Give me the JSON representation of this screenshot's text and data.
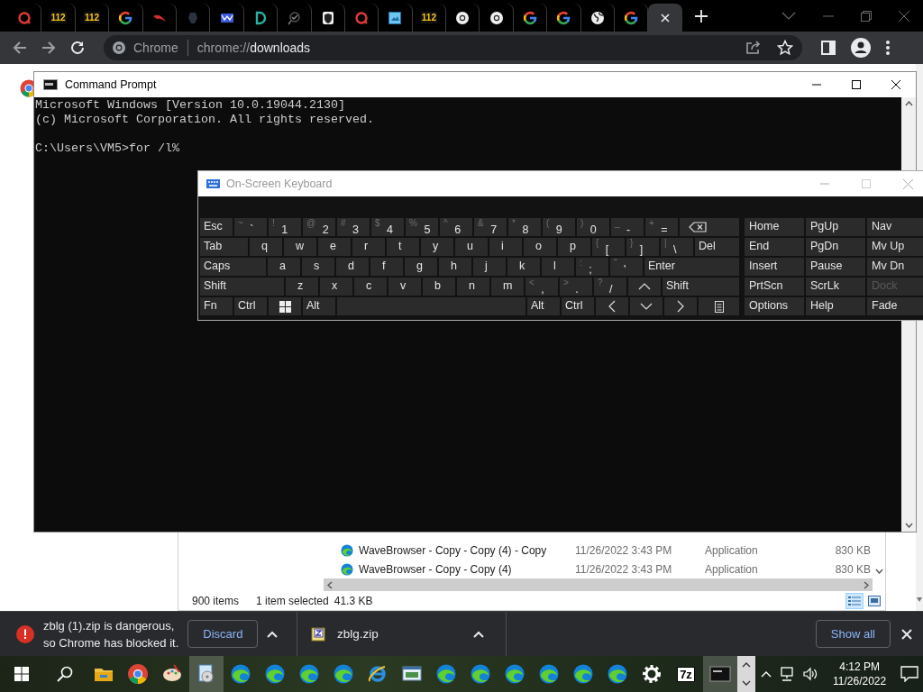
{
  "browser": {
    "tabs": [
      {
        "kind": "ring",
        "selected": false
      },
      {
        "kind": "badge",
        "badge": "112",
        "selected": false
      },
      {
        "kind": "badge",
        "badge": "112",
        "selected": false
      },
      {
        "kind": "google",
        "selected": false
      },
      {
        "kind": "swoosh",
        "selected": false
      },
      {
        "kind": "blot",
        "selected": false
      },
      {
        "kind": "mail",
        "selected": false
      },
      {
        "kind": "arc",
        "selected": false
      },
      {
        "kind": "check",
        "selected": false
      },
      {
        "kind": "shield",
        "selected": false
      },
      {
        "kind": "ring",
        "selected": false
      },
      {
        "kind": "image",
        "selected": false
      },
      {
        "kind": "badge",
        "badge": "112",
        "selected": false
      },
      {
        "kind": "round",
        "selected": false
      },
      {
        "kind": "round",
        "selected": false
      },
      {
        "kind": "google",
        "selected": false
      },
      {
        "kind": "google",
        "selected": false
      },
      {
        "kind": "globe",
        "selected": false
      },
      {
        "kind": "google",
        "selected": false
      },
      {
        "kind": "blank",
        "selected": true
      }
    ],
    "omnibox": {
      "chip": "Chrome",
      "url": "chrome://**downloads**"
    }
  },
  "cmd": {
    "title": "Command Prompt",
    "output": [
      "Microsoft Windows [Version 10.0.19044.2130]",
      "(c) Microsoft Corporation. All rights reserved."
    ],
    "prompt": "C:\\Users\\VM5>for /l%"
  },
  "osk": {
    "title": "On-Screen Keyboard",
    "rows": [
      [
        {
          "kind": "key",
          "label": "Esc"
        },
        {
          "kind": "char",
          "shift": "~",
          "main": "`"
        },
        {
          "kind": "char",
          "shift": "!",
          "main": "1"
        },
        {
          "kind": "char",
          "shift": "@",
          "main": "2"
        },
        {
          "kind": "char",
          "shift": "#",
          "main": "3"
        },
        {
          "kind": "char",
          "shift": "$",
          "main": "4"
        },
        {
          "kind": "char",
          "shift": "%",
          "main": "5"
        },
        {
          "kind": "char",
          "shift": "^",
          "main": "6"
        },
        {
          "kind": "char",
          "shift": "&",
          "main": "7"
        },
        {
          "kind": "char",
          "shift": "*",
          "main": "8"
        },
        {
          "kind": "char",
          "shift": "(",
          "main": "9"
        },
        {
          "kind": "char",
          "shift": ")",
          "main": "0"
        },
        {
          "kind": "char",
          "shift": "_",
          "main": "-"
        },
        {
          "kind": "char",
          "shift": "+",
          "main": "="
        },
        {
          "kind": "backspace"
        }
      ],
      [
        {
          "kind": "key",
          "label": "Tab"
        },
        {
          "kind": "key",
          "label": "q"
        },
        {
          "kind": "key",
          "label": "w"
        },
        {
          "kind": "key",
          "label": "e"
        },
        {
          "kind": "key",
          "label": "r"
        },
        {
          "kind": "key",
          "label": "t"
        },
        {
          "kind": "key",
          "label": "y"
        },
        {
          "kind": "key",
          "label": "u"
        },
        {
          "kind": "key",
          "label": "i"
        },
        {
          "kind": "key",
          "label": "o"
        },
        {
          "kind": "key",
          "label": "p"
        },
        {
          "kind": "char",
          "shift": "{",
          "main": "["
        },
        {
          "kind": "char",
          "shift": "}",
          "main": "]"
        },
        {
          "kind": "char",
          "shift": "|",
          "main": "\\"
        },
        {
          "kind": "key",
          "label": "Del"
        }
      ],
      [
        {
          "kind": "key",
          "label": "Caps"
        },
        {
          "kind": "key",
          "label": "a"
        },
        {
          "kind": "key",
          "label": "s"
        },
        {
          "kind": "key",
          "label": "d"
        },
        {
          "kind": "key",
          "label": "f"
        },
        {
          "kind": "key",
          "label": "g"
        },
        {
          "kind": "key",
          "label": "h"
        },
        {
          "kind": "key",
          "label": "j"
        },
        {
          "kind": "key",
          "label": "k"
        },
        {
          "kind": "key",
          "label": "l"
        },
        {
          "kind": "char",
          "shift": ":",
          "main": ";"
        },
        {
          "kind": "char",
          "shift": "\"",
          "main": "'"
        },
        {
          "kind": "key",
          "label": "Enter"
        }
      ],
      [
        {
          "kind": "key",
          "label": "Shift"
        },
        {
          "kind": "key",
          "label": "z"
        },
        {
          "kind": "key",
          "label": "x"
        },
        {
          "kind": "key",
          "label": "c"
        },
        {
          "kind": "key",
          "label": "v"
        },
        {
          "kind": "key",
          "label": "b"
        },
        {
          "kind": "key",
          "label": "n"
        },
        {
          "kind": "key",
          "label": "m"
        },
        {
          "kind": "char",
          "shift": "<",
          "main": ","
        },
        {
          "kind": "char",
          "shift": ">",
          "main": "."
        },
        {
          "kind": "char",
          "shift": "?",
          "main": "/"
        },
        {
          "kind": "up"
        },
        {
          "kind": "key",
          "label": "Shift"
        }
      ],
      [
        {
          "kind": "key",
          "label": "Fn"
        },
        {
          "kind": "key",
          "label": "Ctrl"
        },
        {
          "kind": "windows"
        },
        {
          "kind": "key",
          "label": "Alt"
        },
        {
          "kind": "space"
        },
        {
          "kind": "key",
          "label": "Alt"
        },
        {
          "kind": "key",
          "label": "Ctrl"
        },
        {
          "kind": "left"
        },
        {
          "kind": "down"
        },
        {
          "kind": "right"
        },
        {
          "kind": "menu"
        }
      ]
    ],
    "nav": [
      {
        "label": "Home",
        "disabled": false
      },
      {
        "label": "PgUp",
        "disabled": false
      },
      {
        "label": "Nav",
        "disabled": false
      },
      {
        "label": "End",
        "disabled": false
      },
      {
        "label": "PgDn",
        "disabled": false
      },
      {
        "label": "Mv Up",
        "disabled": false
      },
      {
        "label": "Insert",
        "disabled": false
      },
      {
        "label": "Pause",
        "disabled": false
      },
      {
        "label": "Mv Dn",
        "disabled": false
      },
      {
        "label": "PrtScn",
        "disabled": false
      },
      {
        "label": "ScrLk",
        "disabled": false
      },
      {
        "label": "Dock",
        "disabled": true
      },
      {
        "label": "Options",
        "disabled": false
      },
      {
        "label": "Help",
        "disabled": false
      },
      {
        "label": "Fade",
        "disabled": false
      }
    ]
  },
  "explorer": {
    "rows": [
      {
        "name": "WaveBrowser - Copy - Copy (4) - Copy",
        "date": "11/26/2022 3:43 PM",
        "type": "Application",
        "size": "830 KB"
      },
      {
        "name": "WaveBrowser - Copy - Copy (4)",
        "date": "11/26/2022 3:43 PM",
        "type": "Application",
        "size": "830 KB"
      }
    ],
    "status": {
      "count": "900 items",
      "selection": "1 item selected",
      "size": "41.3 KB"
    },
    "views": [
      {
        "kind": "details",
        "selected": true
      },
      {
        "kind": "icons",
        "selected": false
      }
    ]
  },
  "download_bar": {
    "items": [
      {
        "kind": "blocked",
        "text": "zblg (1).zip is dangerous,\nso Chrome has blocked it.",
        "action": "Discard"
      },
      {
        "kind": "file",
        "text": "zblg.zip"
      }
    ],
    "show_all": "Show all"
  },
  "taskbar": {
    "apps": [
      {
        "kind": "folder",
        "active": false
      },
      {
        "kind": "chrome",
        "active": false
      },
      {
        "kind": "brush",
        "active": false
      },
      {
        "kind": "disc",
        "active": true
      },
      {
        "kind": "edge",
        "active": false
      },
      {
        "kind": "edge",
        "active": false
      },
      {
        "kind": "edge",
        "active": false
      },
      {
        "kind": "edge",
        "active": false
      },
      {
        "kind": "ie",
        "active": false
      },
      {
        "kind": "window",
        "active": false
      },
      {
        "kind": "edge",
        "active": false
      },
      {
        "kind": "edge",
        "active": false
      },
      {
        "kind": "edge",
        "active": false
      },
      {
        "kind": "edge",
        "active": false
      },
      {
        "kind": "edge",
        "active": false
      },
      {
        "kind": "edge",
        "active": false
      },
      {
        "kind": "gear",
        "active": false
      },
      {
        "kind": "badge",
        "badge": "7z",
        "active": false
      },
      {
        "kind": "console",
        "active": true
      }
    ],
    "clock": {
      "time": "4:12 PM",
      "date": "11/26/2022"
    }
  }
}
